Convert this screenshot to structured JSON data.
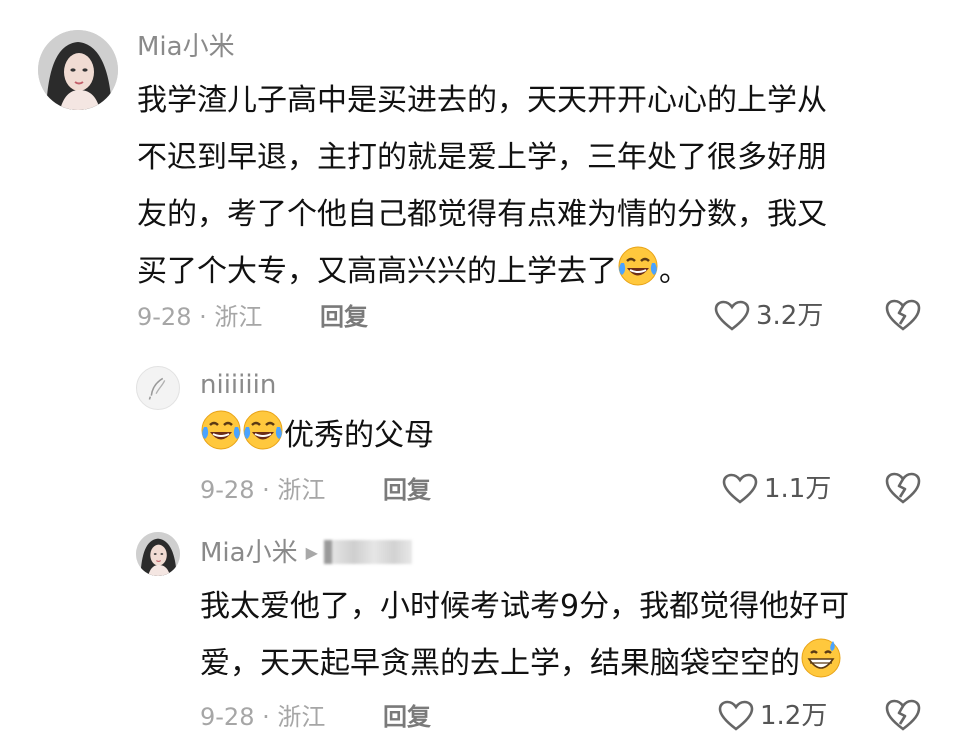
{
  "comments": [
    {
      "username": "Mia小米",
      "lines": [
        "我学渣儿子高中是买进去的，天天开开心心的上学从",
        "不迟到早退，主打的就是爱上学，三年处了很多好朋",
        "友的，考了个他自己都觉得有点难为情的分数，我又",
        "买了个大专，又高高兴兴的上学去了"
      ],
      "trailing_text": "。",
      "trailing_emoji": "crying-laughing-emoji",
      "date_location": "9-28 · 浙江",
      "reply_label": "回复",
      "likes": "3.2万"
    },
    {
      "username": "niiiiiin",
      "lines": [
        "优秀的父母"
      ],
      "leading_emojis": [
        "crying-laughing-emoji",
        "crying-laughing-emoji"
      ],
      "date_location": "9-28 · 浙江",
      "reply_label": "回复",
      "likes": "1.1万"
    },
    {
      "username": "Mia小米",
      "reply_to_arrow": "▶",
      "lines": [
        "我太爱他了，小时候考试考9分，我都觉得他好可",
        "爱，天天起早贪黑的去上学，结果脑袋空空的"
      ],
      "trailing_emoji": "sweat-grin-emoji",
      "date_location": "9-28 · 浙江",
      "reply_label": "回复",
      "likes": "1.2万"
    }
  ],
  "colors": {
    "text": "#111111",
    "meta": "#a6a6a6",
    "username": "#8a8a8a",
    "emoji_yellow": "#ffc83d"
  }
}
